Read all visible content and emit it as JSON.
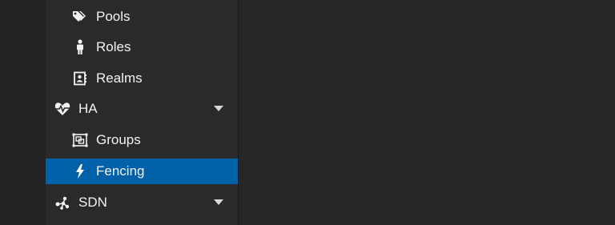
{
  "sidebar": {
    "items": [
      {
        "label": "Pools",
        "icon": "tags-icon",
        "level": "child"
      },
      {
        "label": "Roles",
        "icon": "male-person-icon",
        "level": "child"
      },
      {
        "label": "Realms",
        "icon": "address-book-icon",
        "level": "child"
      },
      {
        "label": "HA",
        "icon": "heartbeat-icon",
        "level": "parent",
        "expanded": true
      },
      {
        "label": "Groups",
        "icon": "object-group-icon",
        "level": "child"
      },
      {
        "label": "Fencing",
        "icon": "bolt-icon",
        "level": "child",
        "selected": true
      },
      {
        "label": "SDN",
        "icon": "sdn-share-icon",
        "level": "parent",
        "expanded": true
      }
    ]
  },
  "colors": {
    "background": "#262626",
    "sidebar": "#2a2a2a",
    "selected": "#0060a8",
    "text": "#f2f2f2"
  }
}
